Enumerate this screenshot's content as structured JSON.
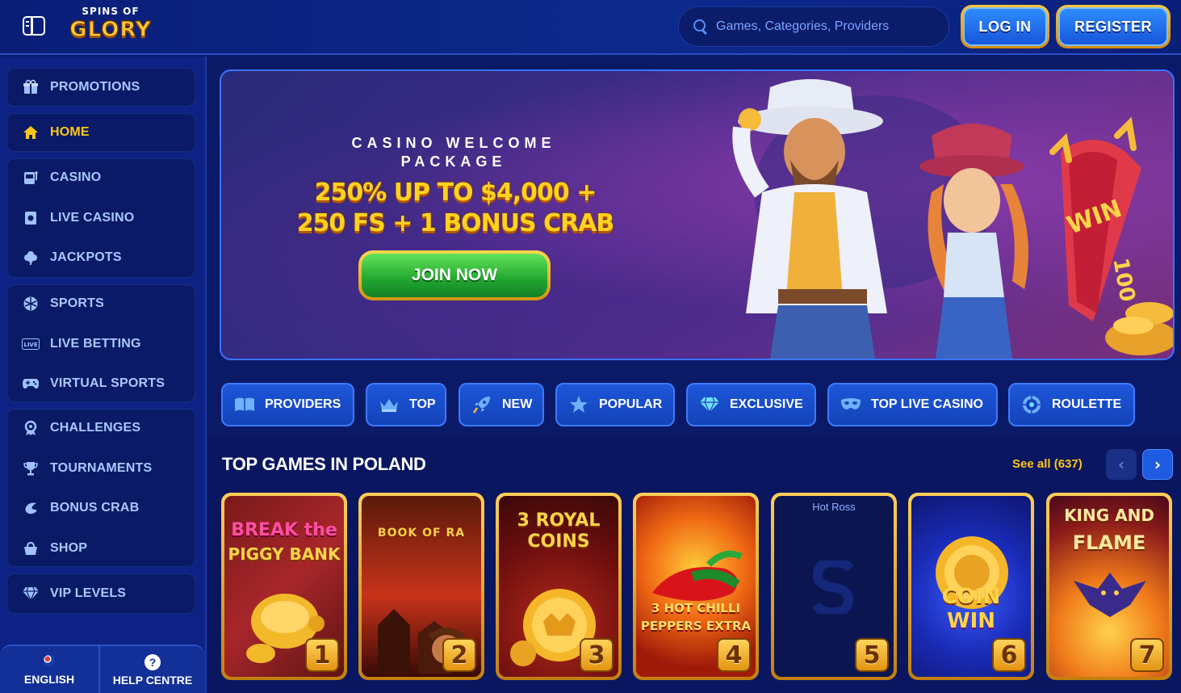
{
  "header": {
    "logo_small": "SPINS OF",
    "logo_big": "GLORY",
    "search_placeholder": "Games, Categories, Providers",
    "login_label": "LOG IN",
    "register_label": "REGISTER"
  },
  "sidebar": {
    "items": [
      {
        "label": "PROMOTIONS",
        "icon": "gift-icon"
      },
      {
        "label": "HOME",
        "icon": "home-icon",
        "active": true
      },
      {
        "label": "CASINO",
        "icon": "slot-machine-icon"
      },
      {
        "label": "LIVE CASINO",
        "icon": "live-casino-icon"
      },
      {
        "label": "JACKPOTS",
        "icon": "clover-icon"
      },
      {
        "label": "SPORTS",
        "icon": "ball-icon"
      },
      {
        "label": "LIVE BETTING",
        "icon": "live-badge-icon"
      },
      {
        "label": "VIRTUAL SPORTS",
        "icon": "gamepad-icon"
      },
      {
        "label": "CHALLENGES",
        "icon": "medal-icon"
      },
      {
        "label": "TOURNAMENTS",
        "icon": "trophy-icon"
      },
      {
        "label": "BONUS CRAB",
        "icon": "crab-icon"
      },
      {
        "label": "SHOP",
        "icon": "basket-icon"
      },
      {
        "label": "VIP LEVELS",
        "icon": "diamond-icon"
      }
    ],
    "language_label": "ENGLISH",
    "help_label": "HELP CENTRE",
    "help_glyph": "?"
  },
  "hero": {
    "eyebrow": "CASINO WELCOME PACKAGE",
    "headline_line1": "250% UP TO $4,000 +",
    "headline_line2": "250 FS + 1 BONUS CRAB",
    "cta_label": "JOIN NOW",
    "wheel_text": "WIN",
    "wheel_number": "100"
  },
  "categories": [
    {
      "label": "PROVIDERS",
      "icon": "book-icon"
    },
    {
      "label": "TOP",
      "icon": "crown-icon"
    },
    {
      "label": "NEW",
      "icon": "rocket-icon"
    },
    {
      "label": "POPULAR",
      "icon": "star-icon"
    },
    {
      "label": "EXCLUSIVE",
      "icon": "gem-icon"
    },
    {
      "label": "TOP LIVE CASINO",
      "icon": "mask-icon"
    },
    {
      "label": "ROULETTE",
      "icon": "roulette-icon"
    }
  ],
  "games_section": {
    "title": "TOP GAMES IN POLAND",
    "see_all": "See all (637)",
    "prev_glyph": "‹",
    "next_glyph": "›",
    "games": [
      {
        "title_line1": "BREAK the",
        "title_line2": "PIGGY BANK",
        "rank": "1"
      },
      {
        "title_line1": "BOOK OF RA",
        "title_line2": "",
        "rank": "2"
      },
      {
        "title_line1": "3 ROYAL",
        "title_line2": "COINS",
        "rank": "3"
      },
      {
        "title_line1": "3 HOT CHILLI",
        "title_line2": "PEPPERS EXTRA",
        "rank": "4"
      },
      {
        "title_line1": "Hot Ross",
        "title_line2": "",
        "rank": "5"
      },
      {
        "title_line1": "COIN",
        "title_line2": "WIN",
        "rank": "6"
      },
      {
        "title_line1": "KING AND",
        "title_line2": "FLAME",
        "rank": "7"
      }
    ]
  },
  "colors": {
    "accent_yellow": "#ffc61a",
    "brand_blue": "#1656d9",
    "sidebar_bg": "#0d2284",
    "cta_green": "#21a62f"
  }
}
